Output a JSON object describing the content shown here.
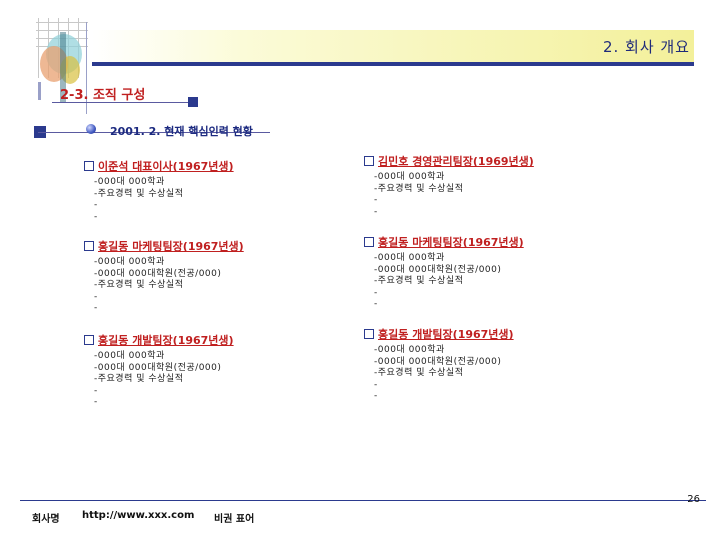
{
  "header": {
    "page_title": "2. 회사 개요"
  },
  "section": {
    "title": "2-3. 조직 구성"
  },
  "subsection": {
    "title": "2001. 2. 현재 핵심인력 현황"
  },
  "people": [
    {
      "name": "이준석 대표이사(1967년생)",
      "lines": [
        "-000대 000학과",
        "-주요경력 및 수상실적",
        "-",
        "-"
      ]
    },
    {
      "name": "김민호 경영관리팀장(1969년생)",
      "lines": [
        "-000대 000학과",
        "-주요경력 및 수상실적",
        "-",
        "-"
      ]
    },
    {
      "name": "홍길동 마케팅팀장(1967년생)",
      "lines": [
        "-000대 000학과",
        "-000대 000대학원(전공/000)",
        "-주요경력 및 수상실적",
        "-",
        "-"
      ]
    },
    {
      "name": "홍길동 마케팅팀장(1967년생)",
      "lines": [
        "-000대 000학과",
        "-000대 000대학원(전공/000)",
        "-주요경력 및 수상실적",
        "-",
        "-"
      ]
    },
    {
      "name": "홍길동 개발팀장(1967년생)",
      "lines": [
        "-000대 000학과",
        "-000대 000대학원(전공/000)",
        "-주요경력 및 수상실적",
        "-",
        "-"
      ]
    },
    {
      "name": "홍길동 개발팀장(1967년생)",
      "lines": [
        "-000대 000학과",
        "-000대 000대학원(전공/000)",
        "-주요경력 및 수상실적",
        "-",
        "-"
      ]
    }
  ],
  "footer": {
    "company": "회사명",
    "url": "http://www.xxx.com",
    "confidential": "비권 표어",
    "page_number": "26"
  }
}
